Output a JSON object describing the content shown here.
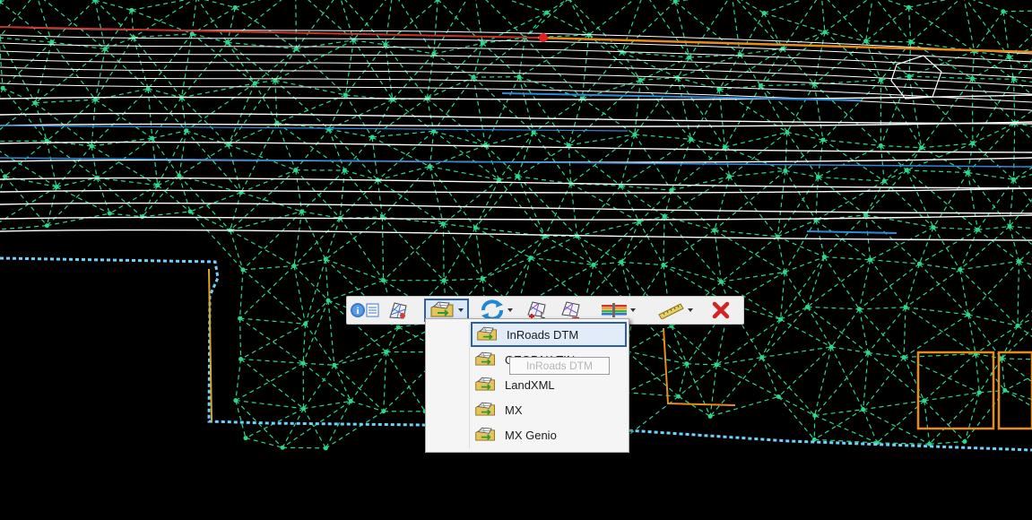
{
  "viewport": {
    "background": "#000000",
    "mesh_color": "#2bd88a",
    "line_colors": [
      "#ffffff",
      "#c8322a",
      "#e98d1a",
      "#2e89d8",
      "#6fd3ff"
    ]
  },
  "toolbar": {
    "buttons": [
      {
        "name": "properties-button",
        "icon": "element-info-icon"
      },
      {
        "name": "terrain-model-button",
        "icon": "terrain-model-icon"
      },
      {
        "name": "import-terrain-button",
        "icon": "terrain-import-icon",
        "has_dropdown": true,
        "active": true
      },
      {
        "name": "refresh-button",
        "icon": "refresh-icon",
        "has_dropdown": true
      },
      {
        "name": "add-feature-button",
        "icon": "terrain-add-icon"
      },
      {
        "name": "remove-feature-button",
        "icon": "terrain-remove-icon"
      },
      {
        "name": "display-style-button",
        "icon": "display-style-icon",
        "has_dropdown": true
      },
      {
        "name": "measure-button",
        "icon": "ruler-icon",
        "has_dropdown": true
      },
      {
        "name": "delete-button",
        "icon": "close-icon"
      }
    ]
  },
  "import_menu": {
    "items": [
      {
        "label": "InRoads DTM",
        "icon": "terrain-import-icon",
        "highlighted": true
      },
      {
        "label": "GEOPAK TIN",
        "icon": "terrain-import-icon"
      },
      {
        "label": "LandXML",
        "icon": "terrain-import-icon"
      },
      {
        "label": "MX",
        "icon": "terrain-import-icon"
      },
      {
        "label": "MX Genio",
        "icon": "terrain-import-icon"
      }
    ],
    "tooltip": "InRoads DTM"
  }
}
